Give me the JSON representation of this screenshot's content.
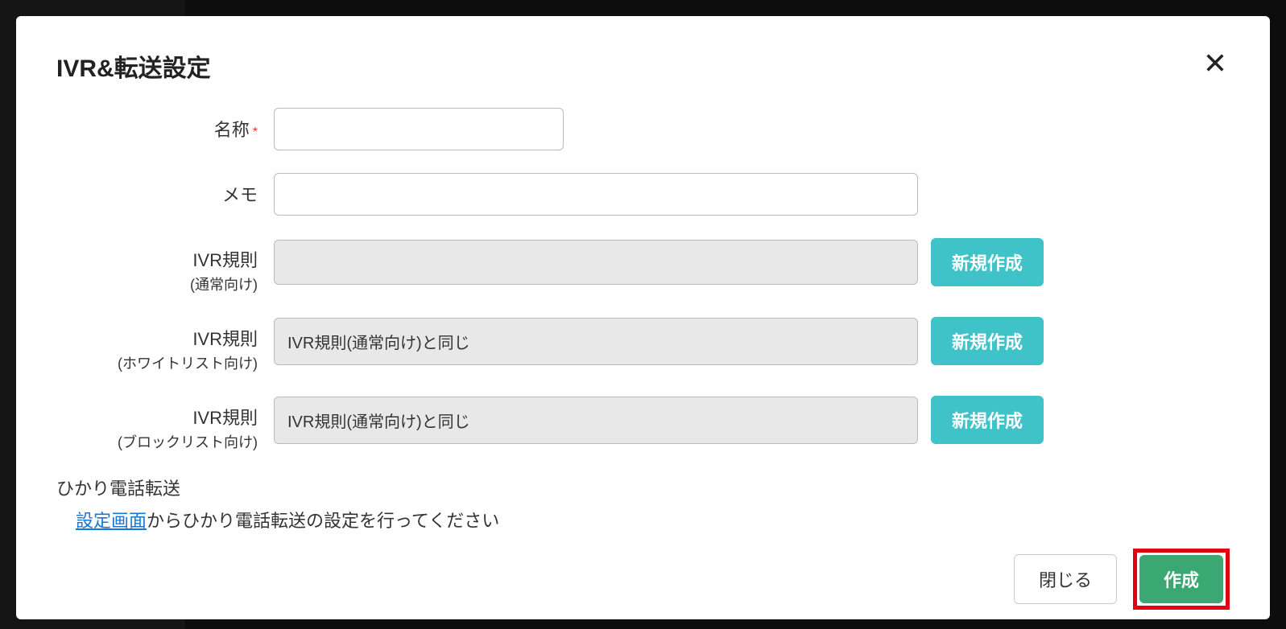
{
  "modal": {
    "title": "IVR&転送設定",
    "close_icon": "close"
  },
  "form": {
    "name": {
      "label": "名称",
      "required": "*",
      "value": ""
    },
    "memo": {
      "label": "メモ",
      "value": ""
    },
    "ivr_normal": {
      "label": "IVR規則",
      "sublabel": "(通常向け)",
      "value": "",
      "create_btn": "新規作成"
    },
    "ivr_whitelist": {
      "label": "IVR規則",
      "sublabel": "(ホワイトリスト向け)",
      "value": "IVR規則(通常向け)と同じ",
      "create_btn": "新規作成"
    },
    "ivr_blocklist": {
      "label": "IVR規則",
      "sublabel": "(ブロックリスト向け)",
      "value": "IVR規則(通常向け)と同じ",
      "create_btn": "新規作成"
    }
  },
  "hikari": {
    "title": "ひかり電話転送",
    "link_text": "設定画面",
    "suffix_text": "からひかり電話転送の設定を行ってください"
  },
  "footer": {
    "close_btn": "閉じる",
    "create_btn": "作成"
  }
}
